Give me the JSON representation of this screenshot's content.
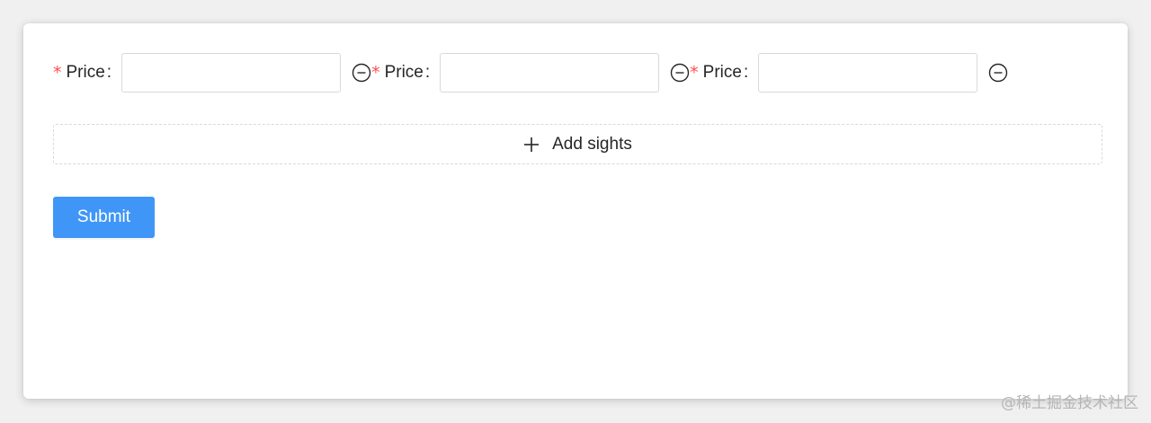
{
  "form": {
    "fields": [
      {
        "required_mark": "*",
        "label": "Price",
        "colon": ":",
        "value": ""
      },
      {
        "required_mark": "*",
        "label": "Price",
        "colon": ":",
        "value": ""
      },
      {
        "required_mark": "*",
        "label": "Price",
        "colon": ":",
        "value": ""
      }
    ],
    "remove_icon": "minus-circle-icon",
    "add_button_label": "Add sights",
    "add_icon": "plus-icon",
    "submit_label": "Submit"
  },
  "colors": {
    "required": "#ff4d4f",
    "primary": "#4096f7",
    "border": "#d9d9d9"
  },
  "watermark": "@稀土掘金技术社区"
}
